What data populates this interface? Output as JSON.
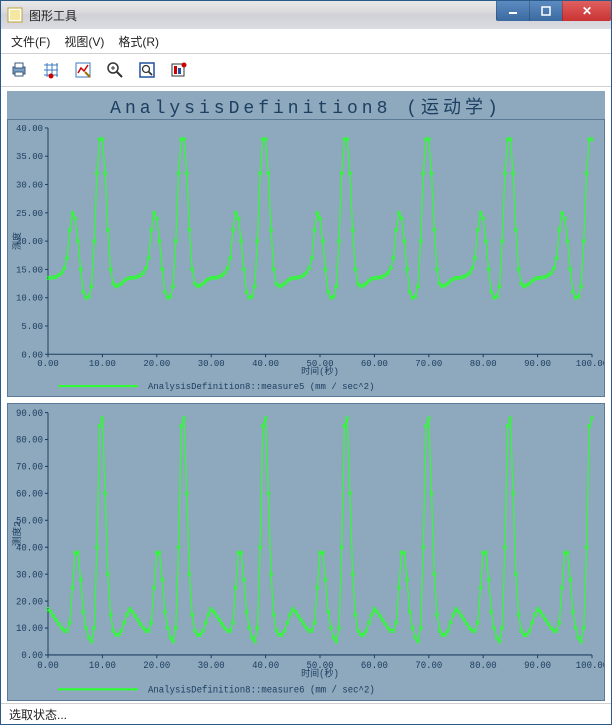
{
  "window": {
    "title": "图形工具",
    "min_tip": "最小化",
    "max_tip": "最大化",
    "close_tip": "关闭"
  },
  "menu": {
    "file": "文件(F)",
    "view": "视图(V)",
    "format": "格式(R)"
  },
  "toolbar": {
    "print": "print",
    "grid": "grid",
    "edit": "edit",
    "zoom_in": "zoom-in",
    "zoom_region": "zoom-region",
    "options": "options"
  },
  "status": {
    "text": "选取状态..."
  },
  "chart": {
    "title": "AnalysisDefinition8 (运动学)"
  },
  "chart_data": [
    {
      "type": "line",
      "title": "",
      "xlabel": "时间(秒)",
      "ylabel": "测度",
      "xlim": [
        0,
        100
      ],
      "ylim": [
        0,
        40
      ],
      "xticks": [
        0,
        10,
        20,
        30,
        40,
        50,
        60,
        70,
        80,
        90,
        100
      ],
      "yticks": [
        0,
        5,
        10,
        15,
        20,
        25,
        30,
        35,
        40
      ],
      "legend": "AnalysisDefinition8::measure5 (mm / sec^2)",
      "series": [
        {
          "name": "measure5",
          "x": [
            0.0,
            0.5,
            1.0,
            1.5,
            2.0,
            2.5,
            3.0,
            3.5,
            4.0,
            4.5,
            5.0,
            5.5,
            6.0,
            6.5,
            7.0,
            7.5,
            8.0,
            8.5,
            9.0,
            9.5,
            10.0,
            10.5,
            11.0,
            11.5,
            12.0,
            12.5,
            13.0,
            13.5,
            14.0,
            14.5,
            15.0,
            15.5,
            16.0,
            16.5,
            17.0,
            17.5,
            18.0,
            18.5,
            19.0,
            19.5,
            20.0,
            20.5,
            21.0,
            21.5,
            22.0,
            22.5,
            23.0,
            23.5,
            24.0,
            24.5,
            25.0,
            25.5,
            26.0,
            26.5,
            27.0,
            27.5,
            28.0,
            28.5,
            29.0,
            29.5,
            30.0,
            30.5,
            31.0,
            31.5,
            32.0,
            32.5,
            33.0,
            33.5,
            34.0,
            34.5,
            35.0,
            35.5,
            36.0,
            36.5,
            37.0,
            37.5,
            38.0,
            38.5,
            39.0,
            39.5,
            40.0,
            40.5,
            41.0,
            41.5,
            42.0,
            42.5,
            43.0,
            43.5,
            44.0,
            44.5,
            45.0,
            45.5,
            46.0,
            46.5,
            47.0,
            47.5,
            48.0,
            48.5,
            49.0,
            49.5,
            50.0,
            50.5,
            51.0,
            51.5,
            52.0,
            52.5,
            53.0,
            53.5,
            54.0,
            54.5,
            55.0,
            55.5,
            56.0,
            56.5,
            57.0,
            57.5,
            58.0,
            58.5,
            59.0,
            59.5,
            60.0,
            60.5,
            61.0,
            61.5,
            62.0,
            62.5,
            63.0,
            63.5,
            64.0,
            64.5,
            65.0,
            65.5,
            66.0,
            66.5,
            67.0,
            67.5,
            68.0,
            68.5,
            69.0,
            69.5,
            70.0,
            70.5,
            71.0,
            71.5,
            72.0,
            72.5,
            73.0,
            73.5,
            74.0,
            74.5,
            75.0,
            75.5,
            76.0,
            76.5,
            77.0,
            77.5,
            78.0,
            78.5,
            79.0,
            79.5,
            80.0,
            80.5,
            81.0,
            81.5,
            82.0,
            82.5,
            83.0,
            83.5,
            84.0,
            84.5,
            85.0,
            85.5,
            86.0,
            86.5,
            87.0,
            87.5,
            88.0,
            88.5,
            89.0,
            89.5,
            90.0,
            90.5,
            91.0,
            91.5,
            92.0,
            92.5,
            93.0,
            93.5,
            94.0,
            94.5,
            95.0,
            95.5,
            96.0,
            96.5,
            97.0,
            97.5,
            98.0,
            98.5,
            99.0,
            99.5,
            100.0
          ],
          "y": [
            13.5,
            13.5,
            13.6,
            13.7,
            14.0,
            14.4,
            15.2,
            17.0,
            22.0,
            25.0,
            24.0,
            20.0,
            15.0,
            11.0,
            10.0,
            10.2,
            12.0,
            20.0,
            32.0,
            38.0,
            38.0,
            32.0,
            22.0,
            15.0,
            12.5,
            12.0,
            12.2,
            12.5,
            13.0,
            13.3,
            13.5,
            13.5,
            13.6,
            13.7,
            14.0,
            14.4,
            15.2,
            17.0,
            22.0,
            25.0,
            24.0,
            20.0,
            15.0,
            11.0,
            10.0,
            10.2,
            12.0,
            20.0,
            32.0,
            38.0,
            38.0,
            32.0,
            22.0,
            15.0,
            12.5,
            12.0,
            12.2,
            12.5,
            13.0,
            13.3,
            13.5,
            13.5,
            13.6,
            13.7,
            14.0,
            14.4,
            15.2,
            17.0,
            22.0,
            25.0,
            24.0,
            20.0,
            15.0,
            11.0,
            10.0,
            10.2,
            12.0,
            20.0,
            32.0,
            38.0,
            38.0,
            32.0,
            22.0,
            15.0,
            12.5,
            12.0,
            12.2,
            12.5,
            13.0,
            13.3,
            13.5,
            13.5,
            13.6,
            13.7,
            14.0,
            14.4,
            15.2,
            17.0,
            22.0,
            25.0,
            24.0,
            20.0,
            15.0,
            11.0,
            10.0,
            10.2,
            12.0,
            20.0,
            32.0,
            38.0,
            38.0,
            32.0,
            22.0,
            15.0,
            12.5,
            12.0,
            12.2,
            12.5,
            13.0,
            13.3,
            13.5,
            13.5,
            13.6,
            13.7,
            14.0,
            14.4,
            15.2,
            17.0,
            22.0,
            25.0,
            24.0,
            20.0,
            15.0,
            11.0,
            10.0,
            10.2,
            12.0,
            20.0,
            32.0,
            38.0,
            38.0,
            32.0,
            22.0,
            15.0,
            12.5,
            12.0,
            12.2,
            12.5,
            13.0,
            13.3,
            13.5,
            13.5,
            13.6,
            13.7,
            14.0,
            14.4,
            15.2,
            17.0,
            22.0,
            25.0,
            24.0,
            20.0,
            15.0,
            11.0,
            10.0,
            10.2,
            12.0,
            20.0,
            32.0,
            38.0,
            38.0,
            32.0,
            22.0,
            15.0,
            12.5,
            12.0,
            12.2,
            12.5,
            13.0,
            13.3,
            13.5,
            13.5,
            13.6,
            13.7,
            14.0,
            14.4,
            15.2,
            17.0,
            22.0,
            25.0,
            24.0,
            20.0,
            15.0,
            11.0,
            10.0,
            10.2,
            12.0,
            20.0,
            32.0,
            38.0,
            38.0
          ]
        }
      ]
    },
    {
      "type": "line",
      "title": "",
      "xlabel": "时间(秒)",
      "ylabel": "测度2",
      "xlim": [
        0,
        100
      ],
      "ylim": [
        0,
        90
      ],
      "xticks": [
        0,
        10,
        20,
        30,
        40,
        50,
        60,
        70,
        80,
        90,
        100
      ],
      "yticks": [
        0,
        10,
        20,
        30,
        40,
        50,
        60,
        70,
        80,
        90
      ],
      "legend": "AnalysisDefinition8::measure6 (mm / sec^2)",
      "series": [
        {
          "name": "measure6",
          "x": [
            0.0,
            0.5,
            1.0,
            1.5,
            2.0,
            2.5,
            3.0,
            3.5,
            4.0,
            4.5,
            5.0,
            5.5,
            6.0,
            6.5,
            7.0,
            7.5,
            8.0,
            8.5,
            9.0,
            9.5,
            10.0,
            10.5,
            11.0,
            11.5,
            12.0,
            12.5,
            13.0,
            13.5,
            14.0,
            14.5,
            15.0,
            15.5,
            16.0,
            16.5,
            17.0,
            17.5,
            18.0,
            18.5,
            19.0,
            19.5,
            20.0,
            20.5,
            21.0,
            21.5,
            22.0,
            22.5,
            23.0,
            23.5,
            24.0,
            24.5,
            25.0,
            25.5,
            26.0,
            26.5,
            27.0,
            27.5,
            28.0,
            28.5,
            29.0,
            29.5,
            30.0,
            30.5,
            31.0,
            31.5,
            32.0,
            32.5,
            33.0,
            33.5,
            34.0,
            34.5,
            35.0,
            35.5,
            36.0,
            36.5,
            37.0,
            37.5,
            38.0,
            38.5,
            39.0,
            39.5,
            40.0,
            40.5,
            41.0,
            41.5,
            42.0,
            42.5,
            43.0,
            43.5,
            44.0,
            44.5,
            45.0,
            45.5,
            46.0,
            46.5,
            47.0,
            47.5,
            48.0,
            48.5,
            49.0,
            49.5,
            50.0,
            50.5,
            51.0,
            51.5,
            52.0,
            52.5,
            53.0,
            53.5,
            54.0,
            54.5,
            55.0,
            55.5,
            56.0,
            56.5,
            57.0,
            57.5,
            58.0,
            58.5,
            59.0,
            59.5,
            60.0,
            60.5,
            61.0,
            61.5,
            62.0,
            62.5,
            63.0,
            63.5,
            64.0,
            64.5,
            65.0,
            65.5,
            66.0,
            66.5,
            67.0,
            67.5,
            68.0,
            68.5,
            69.0,
            69.5,
            70.0,
            70.5,
            71.0,
            71.5,
            72.0,
            72.5,
            73.0,
            73.5,
            74.0,
            74.5,
            75.0,
            75.5,
            76.0,
            76.5,
            77.0,
            77.5,
            78.0,
            78.5,
            79.0,
            79.5,
            80.0,
            80.5,
            81.0,
            81.5,
            82.0,
            82.5,
            83.0,
            83.5,
            84.0,
            84.5,
            85.0,
            85.5,
            86.0,
            86.5,
            87.0,
            87.5,
            88.0,
            88.5,
            89.0,
            89.5,
            90.0,
            90.5,
            91.0,
            91.5,
            92.0,
            92.5,
            93.0,
            93.5,
            94.0,
            94.5,
            95.0,
            95.5,
            96.0,
            96.5,
            97.0,
            97.5,
            98.0,
            98.5,
            99.0,
            99.5,
            100.0
          ],
          "y": [
            17.0,
            16.0,
            14.5,
            13.0,
            11.5,
            10.0,
            9.0,
            9.0,
            12.0,
            25.0,
            38.0,
            38.0,
            28.0,
            16.0,
            10.0,
            6.5,
            5.0,
            10.0,
            40.0,
            85.0,
            88.0,
            60.0,
            30.0,
            15.0,
            9.0,
            7.5,
            7.5,
            9.0,
            12.0,
            15.0,
            17.0,
            16.0,
            14.5,
            13.0,
            11.5,
            10.0,
            9.0,
            9.0,
            12.0,
            25.0,
            38.0,
            38.0,
            28.0,
            16.0,
            10.0,
            6.5,
            5.0,
            10.0,
            40.0,
            85.0,
            88.0,
            60.0,
            30.0,
            15.0,
            9.0,
            7.5,
            7.5,
            9.0,
            12.0,
            15.0,
            17.0,
            16.0,
            14.5,
            13.0,
            11.5,
            10.0,
            9.0,
            9.0,
            12.0,
            25.0,
            38.0,
            38.0,
            28.0,
            16.0,
            10.0,
            6.5,
            5.0,
            10.0,
            40.0,
            85.0,
            88.0,
            60.0,
            30.0,
            15.0,
            9.0,
            7.5,
            7.5,
            9.0,
            12.0,
            15.0,
            17.0,
            16.0,
            14.5,
            13.0,
            11.5,
            10.0,
            9.0,
            9.0,
            12.0,
            25.0,
            38.0,
            38.0,
            28.0,
            16.0,
            10.0,
            6.5,
            5.0,
            10.0,
            40.0,
            85.0,
            88.0,
            60.0,
            30.0,
            15.0,
            9.0,
            7.5,
            7.5,
            9.0,
            12.0,
            15.0,
            17.0,
            16.0,
            14.5,
            13.0,
            11.5,
            10.0,
            9.0,
            9.0,
            12.0,
            25.0,
            38.0,
            38.0,
            28.0,
            16.0,
            10.0,
            6.5,
            5.0,
            10.0,
            40.0,
            85.0,
            88.0,
            60.0,
            30.0,
            15.0,
            9.0,
            7.5,
            7.5,
            9.0,
            12.0,
            15.0,
            17.0,
            16.0,
            14.5,
            13.0,
            11.5,
            10.0,
            9.0,
            9.0,
            12.0,
            25.0,
            38.0,
            38.0,
            28.0,
            16.0,
            10.0,
            6.5,
            5.0,
            10.0,
            40.0,
            85.0,
            88.0,
            60.0,
            30.0,
            15.0,
            9.0,
            7.5,
            7.5,
            9.0,
            12.0,
            15.0,
            17.0,
            16.0,
            14.5,
            13.0,
            11.5,
            10.0,
            9.0,
            9.0,
            12.0,
            25.0,
            38.0,
            38.0,
            28.0,
            16.0,
            10.0,
            6.5,
            5.0,
            10.0,
            40.0,
            85.0,
            88.0
          ]
        }
      ]
    }
  ]
}
